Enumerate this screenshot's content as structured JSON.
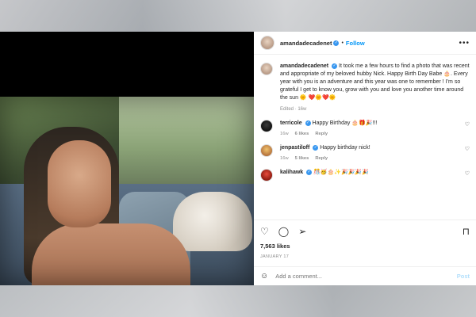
{
  "post": {
    "author": "amandadecadenet",
    "follow_label": "Follow",
    "more_icon": "more-horizontal-icon",
    "caption": {
      "username": "amandadecadenet",
      "text": "It took me a few hours to find a photo that was recent and appropriate of my beloved hubby Nick. Happy Birth Day Babe 🎂. Every year with you is an adventure and this year was one to remember ! I’m so grateful I get to know you, grow with you and love you another time around the sun 🌞 ❤️🌞❤️🌞",
      "meta": "Edited · 16w"
    },
    "comments": [
      {
        "username": "terricole",
        "text": "Happy Birthday 🎂🎁🎉!!!",
        "time": "16w",
        "likes": "6 likes",
        "reply": "Reply"
      },
      {
        "username": "jenpastiloff",
        "text": "Happy birthday nick!",
        "time": "16w",
        "likes": "5 likes",
        "reply": "Reply"
      },
      {
        "username": "kalihawk",
        "text": "🎊🥳🎂✨🎉🎉🎉🎉",
        "time": "16w",
        "likes": "",
        "reply": "Reply"
      }
    ],
    "likes": "7,563 likes",
    "date": "JANUARY 17",
    "add_comment_placeholder": "Add a comment...",
    "post_label": "Post"
  }
}
